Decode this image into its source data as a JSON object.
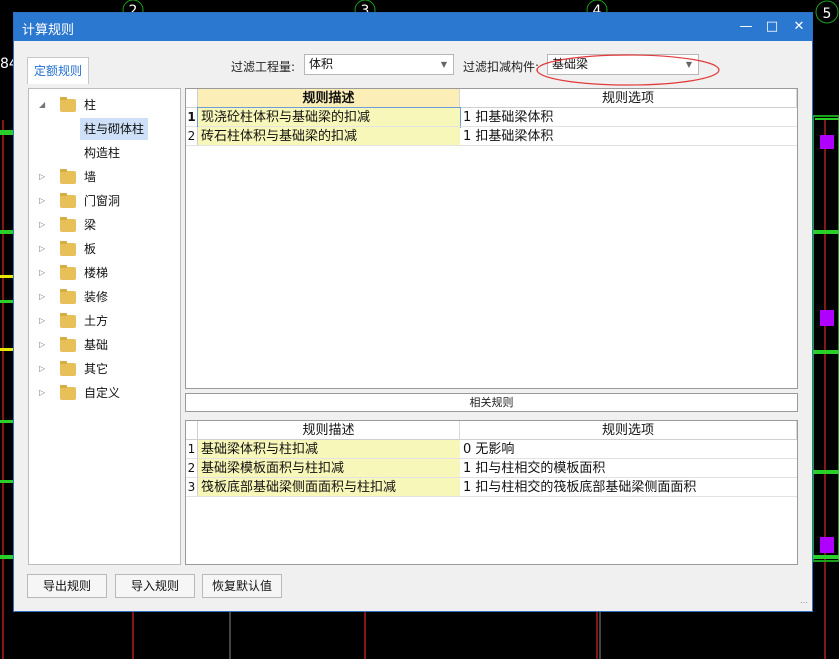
{
  "background": {
    "axis_markers": [
      "2",
      "3",
      "4",
      "5"
    ],
    "edge_number": "84"
  },
  "window": {
    "title": "计算规则",
    "controls": [
      "minimize",
      "maximize",
      "close"
    ]
  },
  "tab": {
    "label": "定额规则"
  },
  "filters": {
    "quantity_label": "过滤工程量:",
    "quantity_value": "体积",
    "component_label": "过滤扣减构件:",
    "component_value": "基础梁"
  },
  "tree": {
    "items": [
      {
        "label": "柱",
        "expanded": true
      },
      {
        "label": "柱与砌体柱",
        "selected": true
      },
      {
        "label": "构造柱"
      },
      {
        "label": "墙"
      },
      {
        "label": "门窗洞"
      },
      {
        "label": "梁"
      },
      {
        "label": "板"
      },
      {
        "label": "楼梯"
      },
      {
        "label": "装修"
      },
      {
        "label": "土方"
      },
      {
        "label": "基础"
      },
      {
        "label": "其它"
      },
      {
        "label": "自定义"
      }
    ]
  },
  "rules_table": {
    "headers": [
      "规则描述",
      "规则选项"
    ],
    "rows": [
      {
        "num": "1",
        "description": "现浇砼柱体积与基础梁的扣减",
        "option": "1  扣基础梁体积"
      },
      {
        "num": "2",
        "description": "砖石柱体积与基础梁的扣减",
        "option": "1  扣基础梁体积"
      }
    ]
  },
  "related": {
    "title": "相关规则",
    "headers": [
      "规则描述",
      "规则选项"
    ],
    "rows": [
      {
        "num": "1",
        "description": "基础梁体积与柱扣减",
        "option": "0    无影响"
      },
      {
        "num": "2",
        "description": "基础梁模板面积与柱扣减",
        "option": "1  扣与柱相交的模板面积"
      },
      {
        "num": "3",
        "description": "筏板底部基础梁侧面面积与柱扣减",
        "option": "1  扣与柱相交的筏板底部基础梁侧面面积"
      }
    ]
  },
  "buttons": {
    "export": "导出规则",
    "import": "导入规则",
    "restore": "恢复默认值"
  },
  "colors": {
    "titlebar": "#2b78d0",
    "highlight_cell": "#f7f7b9",
    "annotation_ellipse": "#e23b3b"
  }
}
